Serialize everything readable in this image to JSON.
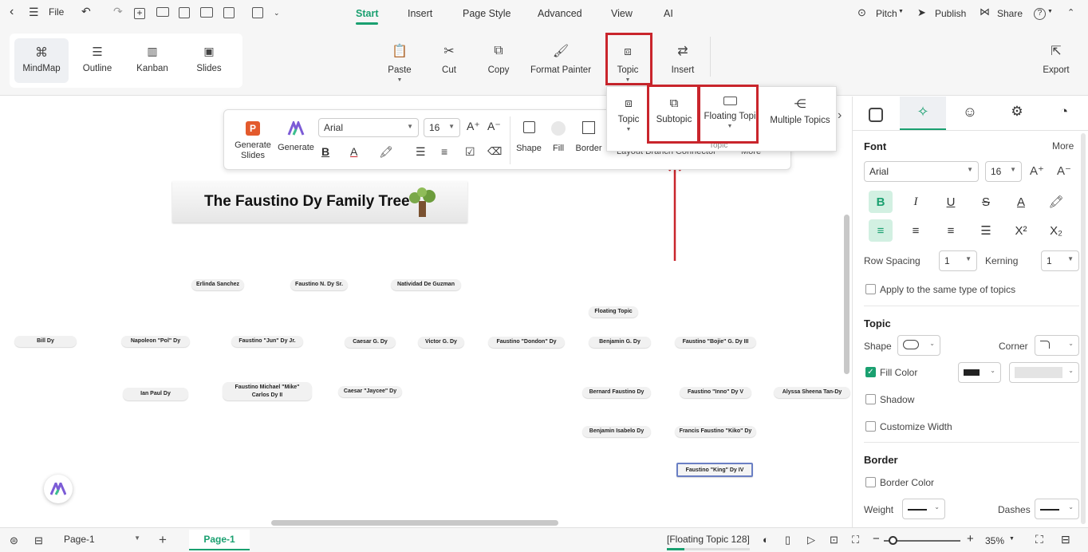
{
  "topbar": {
    "file": "File",
    "tabs": [
      "Start",
      "Insert",
      "Page Style",
      "Advanced",
      "View",
      "AI"
    ],
    "pitch": "Pitch",
    "publish": "Publish",
    "share": "Share"
  },
  "ribbon": {
    "views": [
      "MindMap",
      "Outline",
      "Kanban",
      "Slides"
    ],
    "paste": "Paste",
    "cut": "Cut",
    "copy": "Copy",
    "format_painter": "Format Painter",
    "topic": "Topic",
    "insert": "Insert",
    "export": "Export"
  },
  "float": {
    "gen_slides": "Generate Slides",
    "generate": "Generate",
    "font": "Arial",
    "size": "16",
    "shape": "Shape",
    "fill": "Fill",
    "border": "Border",
    "behind": "Layout  Branch  Connector",
    "more": "More"
  },
  "dropdown": {
    "topic": "Topic",
    "subtopic": "Subtopic",
    "floating": "Floating Topi",
    "multiple": "Multiple Topics",
    "caption": "Topic"
  },
  "canvas": {
    "title": "The Faustino Dy Family Tree",
    "nodes": [
      "Erlinda Sanchez",
      "Faustino N. Dy Sr.",
      "Natividad De Guzman",
      "Floating Topic",
      "Bill Dy",
      "Napoleon \"Pol\" Dy",
      "Faustino \"Jun\" Dy Jr.",
      "Caesar G. Dy",
      "Victor G. Dy",
      "Faustino \"Dondon\" Dy",
      "Benjamin G. Dy",
      "Faustino \"Bojie\" G. Dy III",
      "Ian Paul Dy",
      "Faustino Michael \"Mike\" Carlos Dy II",
      "Caesar \"Jaycee\" Dy",
      "Bernard Faustino Dy",
      "Faustino \"Inno\" Dy V",
      "Alyssa Sheena Tan-Dy",
      "Benjamin Isabelo Dy",
      "Francis Faustino \"Kiko\" Dy",
      "Faustino \"King\" Dy IV"
    ]
  },
  "panel": {
    "font_h": "Font",
    "more": "More",
    "font": "Arial",
    "size": "16",
    "row_spacing": "Row Spacing",
    "row_val": "1",
    "kerning": "Kerning",
    "kern_val": "1",
    "apply": "Apply to the same type of topics",
    "topic_h": "Topic",
    "shape": "Shape",
    "corner": "Corner",
    "fill_color": "Fill Color",
    "shadow": "Shadow",
    "custom_width": "Customize Width",
    "border_h": "Border",
    "border_color": "Border Color",
    "weight": "Weight",
    "dashes": "Dashes"
  },
  "status": {
    "page_select": "Page-1",
    "page_tab": "Page-1",
    "floating": "[Floating Topic 128]",
    "zoom": "35%"
  }
}
